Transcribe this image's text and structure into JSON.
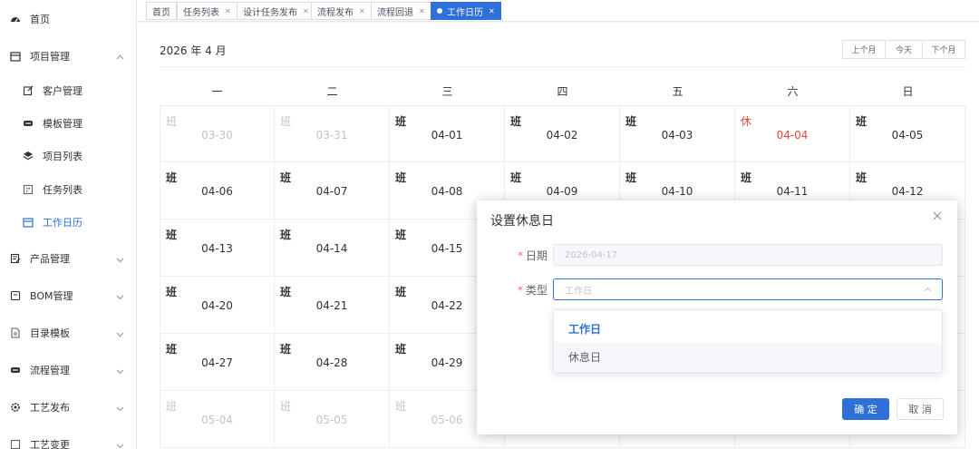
{
  "sidebar": {
    "items": [
      {
        "name": "home",
        "label": "首页",
        "icon": "dashboard-icon"
      },
      {
        "name": "project-mgmt",
        "label": "项目管理",
        "icon": "calendar-icon",
        "expanded": true
      },
      {
        "name": "customer-mgmt",
        "label": "客户管理",
        "icon": "edit-icon",
        "sub": true
      },
      {
        "name": "template-mgmt",
        "label": "模板管理",
        "icon": "minus-box-icon",
        "sub": true
      },
      {
        "name": "project-list",
        "label": "项目列表",
        "icon": "layers-icon",
        "sub": true
      },
      {
        "name": "task-list",
        "label": "任务列表",
        "icon": "building-icon",
        "sub": true
      },
      {
        "name": "work-calendar",
        "label": "工作日历",
        "icon": "calendar-icon",
        "sub": true,
        "active": true
      },
      {
        "name": "product-mgmt",
        "label": "产品管理",
        "icon": "document-edit-icon"
      },
      {
        "name": "bom-mgmt",
        "label": "BOM管理",
        "icon": "archive-icon"
      },
      {
        "name": "catalog-template",
        "label": "目录模板",
        "icon": "file-icon"
      },
      {
        "name": "process-mgmt",
        "label": "流程管理",
        "icon": "minus-box-icon"
      },
      {
        "name": "craft-release",
        "label": "工艺发布",
        "icon": "gear-icon"
      },
      {
        "name": "craft-change",
        "label": "工艺变更",
        "icon": "file-icon"
      }
    ]
  },
  "tabs": [
    {
      "label": "首页",
      "closable": false
    },
    {
      "label": "任务列表",
      "closable": true
    },
    {
      "label": "设计任务发布",
      "closable": true
    },
    {
      "label": "流程发布",
      "closable": true
    },
    {
      "label": "流程回退",
      "closable": true
    },
    {
      "label": "工作日历",
      "closable": true,
      "active": true
    }
  ],
  "calendar": {
    "title": "2026 年 4 月",
    "buttons": {
      "prev": "上个月",
      "today": "今天",
      "next": "下个月"
    },
    "weekdays": [
      "一",
      "二",
      "三",
      "四",
      "五",
      "六",
      "日"
    ],
    "cells": [
      {
        "type": "班",
        "date": "03-30",
        "state": "other"
      },
      {
        "type": "班",
        "date": "03-31",
        "state": "other"
      },
      {
        "type": "班",
        "date": "04-01",
        "state": "work"
      },
      {
        "type": "班",
        "date": "04-02",
        "state": "work"
      },
      {
        "type": "班",
        "date": "04-03",
        "state": "work"
      },
      {
        "type": "休",
        "date": "04-04",
        "state": "rest"
      },
      {
        "type": "班",
        "date": "04-05",
        "state": "work"
      },
      {
        "type": "班",
        "date": "04-06",
        "state": "work"
      },
      {
        "type": "班",
        "date": "04-07",
        "state": "work"
      },
      {
        "type": "班",
        "date": "04-08",
        "state": "work"
      },
      {
        "type": "班",
        "date": "04-09",
        "state": "work"
      },
      {
        "type": "班",
        "date": "04-10",
        "state": "work"
      },
      {
        "type": "班",
        "date": "04-11",
        "state": "work"
      },
      {
        "type": "班",
        "date": "04-12",
        "state": "work"
      },
      {
        "type": "班",
        "date": "04-13",
        "state": "work"
      },
      {
        "type": "班",
        "date": "04-14",
        "state": "work"
      },
      {
        "type": "班",
        "date": "04-15",
        "state": "work"
      },
      {
        "type": "",
        "date": "",
        "state": "work"
      },
      {
        "type": "",
        "date": "",
        "state": "work"
      },
      {
        "type": "",
        "date": "",
        "state": "work"
      },
      {
        "type": "",
        "date": "",
        "state": "work"
      },
      {
        "type": "班",
        "date": "04-20",
        "state": "work"
      },
      {
        "type": "班",
        "date": "04-21",
        "state": "work"
      },
      {
        "type": "班",
        "date": "04-22",
        "state": "work"
      },
      {
        "type": "",
        "date": "",
        "state": "work"
      },
      {
        "type": "",
        "date": "",
        "state": "work"
      },
      {
        "type": "",
        "date": "",
        "state": "work"
      },
      {
        "type": "",
        "date": "",
        "state": "work"
      },
      {
        "type": "班",
        "date": "04-27",
        "state": "work"
      },
      {
        "type": "班",
        "date": "04-28",
        "state": "work"
      },
      {
        "type": "班",
        "date": "04-29",
        "state": "work"
      },
      {
        "type": "",
        "date": "",
        "state": "work"
      },
      {
        "type": "",
        "date": "",
        "state": "work"
      },
      {
        "type": "",
        "date": "",
        "state": "work"
      },
      {
        "type": "",
        "date": "",
        "state": "work"
      },
      {
        "type": "班",
        "date": "05-04",
        "state": "other"
      },
      {
        "type": "班",
        "date": "05-05",
        "state": "other"
      },
      {
        "type": "班",
        "date": "05-06",
        "state": "other"
      },
      {
        "type": "",
        "date": "",
        "state": "other"
      },
      {
        "type": "",
        "date": "",
        "state": "other"
      },
      {
        "type": "",
        "date": "",
        "state": "other"
      },
      {
        "type": "",
        "date": "",
        "state": "other"
      }
    ]
  },
  "dialog": {
    "title": "设置休息日",
    "date_label": "日期",
    "date_value": "2026-04-17",
    "type_label": "类型",
    "type_value": "工作日",
    "options": [
      "工作日",
      "休息日"
    ],
    "confirm": "确 定",
    "cancel": "取 消"
  },
  "colors": {
    "accent": "#2e6fd8",
    "rest": "#e0493d",
    "muted": "#c0c4cc"
  }
}
